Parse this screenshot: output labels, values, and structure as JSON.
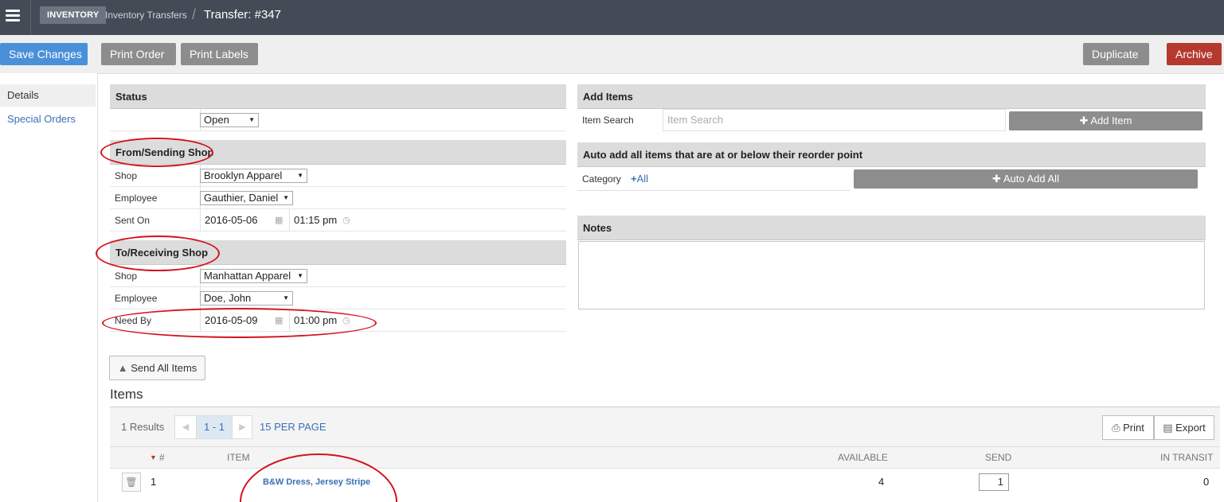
{
  "header": {
    "section_badge": "INVENTORY",
    "breadcrumb_link": "Inventory Transfers",
    "separator": "/",
    "title": "Transfer: #347"
  },
  "toolbar": {
    "save": "Save Changes",
    "print_order": "Print Order",
    "print_labels": "Print Labels",
    "duplicate": "Duplicate",
    "archive": "Archive"
  },
  "sidebar": {
    "items": [
      {
        "label": "Details"
      },
      {
        "label": "Special Orders"
      }
    ]
  },
  "status": {
    "heading": "Status",
    "value": "Open"
  },
  "from_shop": {
    "heading": "From/Sending Shop",
    "shop_label": "Shop",
    "shop_value": "Brooklyn Apparel",
    "employee_label": "Employee",
    "employee_value": "Gauthier, Daniel",
    "date_label": "Sent On",
    "date_value": "2016-05-06",
    "time_value": "01:15 pm"
  },
  "to_shop": {
    "heading": "To/Receiving Shop",
    "shop_label": "Shop",
    "shop_value": "Manhattan Apparel",
    "employee_label": "Employee",
    "employee_value": "Doe, John",
    "date_label": "Need By",
    "date_value": "2016-05-09",
    "time_value": "01:00 pm"
  },
  "add_items": {
    "heading": "Add Items",
    "search_label": "Item Search",
    "search_placeholder": "Item Search",
    "add_button": "Add Item"
  },
  "auto_add": {
    "heading": "Auto add all items that are at or below their reorder point",
    "category_label": "Category",
    "category_value": "All",
    "button": "Auto Add All"
  },
  "notes": {
    "heading": "Notes",
    "value": ""
  },
  "send_all_button": "Send All Items",
  "items": {
    "heading": "Items",
    "results": "1 Results",
    "page_range": "1 - 1",
    "per_page": "15 PER PAGE",
    "print": "Print",
    "export": "Export",
    "columns": {
      "num": "#",
      "item": "ITEM",
      "available": "AVAILABLE",
      "send": "SEND",
      "in_transit": "IN TRANSIT"
    },
    "rows": [
      {
        "num": "1",
        "item": "B&W Dress, Jersey Stripe",
        "available": "4",
        "send": "1",
        "in_transit": "0"
      }
    ]
  },
  "colors": {
    "topbar": "#434c56",
    "save_blue": "#4a90d9",
    "button_gray": "#8d8d8d",
    "archive_red": "#b5392f",
    "annotation_red": "#d4121e",
    "link_blue": "#3a70b5"
  },
  "icons": [
    "hamburger-menu-icon",
    "calendar-icon",
    "clock-icon",
    "plus-icon",
    "warning-icon",
    "chevron-left-icon",
    "chevron-right-icon",
    "printer-icon",
    "export-file-icon",
    "trash-icon",
    "sort-down-icon",
    "select-caret-icon"
  ]
}
